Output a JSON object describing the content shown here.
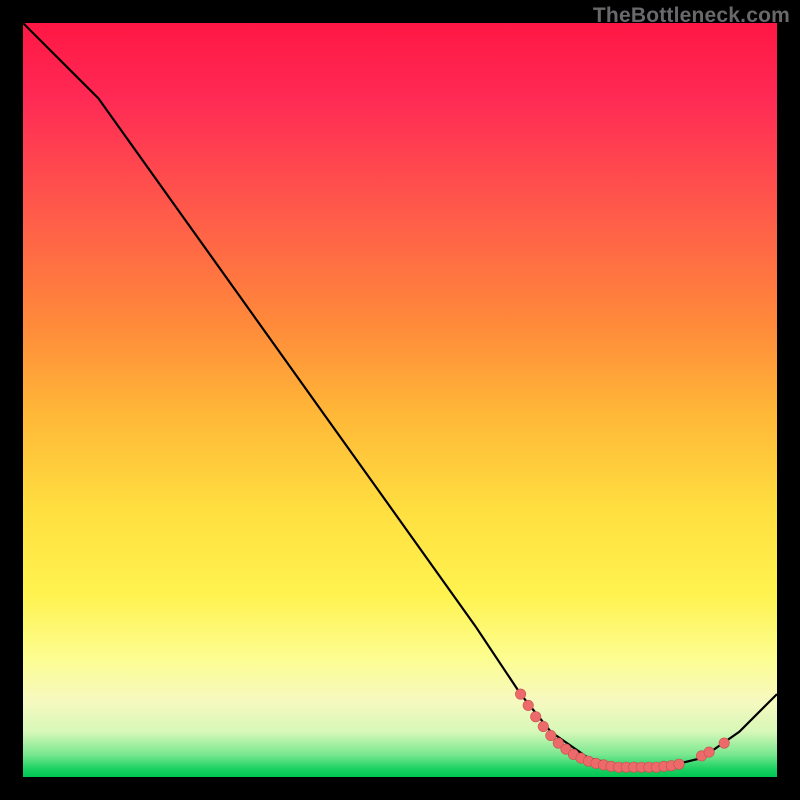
{
  "watermark": "TheBottleneck.com",
  "colors": {
    "curve_stroke": "#000000",
    "point_fill": "#ed6a6a",
    "point_stroke": "#c94f4f"
  },
  "chart_data": {
    "type": "line",
    "title": "",
    "xlabel": "",
    "ylabel": "",
    "xlim": [
      0,
      100
    ],
    "ylim": [
      0,
      100
    ],
    "curve": {
      "x": [
        0,
        3,
        6,
        10,
        20,
        30,
        40,
        50,
        60,
        66,
        70,
        75,
        80,
        85,
        90,
        95,
        100
      ],
      "y": [
        100,
        97,
        94,
        90,
        76,
        62,
        48,
        34,
        20,
        11,
        6,
        2.5,
        1.3,
        1.3,
        2.5,
        6,
        11
      ]
    },
    "points": [
      {
        "x": 66,
        "y": 11.0
      },
      {
        "x": 67,
        "y": 9.5
      },
      {
        "x": 68,
        "y": 8.0
      },
      {
        "x": 69,
        "y": 6.7
      },
      {
        "x": 70,
        "y": 5.5
      },
      {
        "x": 71,
        "y": 4.5
      },
      {
        "x": 72,
        "y": 3.7
      },
      {
        "x": 73,
        "y": 3.0
      },
      {
        "x": 74,
        "y": 2.5
      },
      {
        "x": 75,
        "y": 2.1
      },
      {
        "x": 76,
        "y": 1.8
      },
      {
        "x": 77,
        "y": 1.6
      },
      {
        "x": 78,
        "y": 1.4
      },
      {
        "x": 79,
        "y": 1.3
      },
      {
        "x": 80,
        "y": 1.3
      },
      {
        "x": 81,
        "y": 1.3
      },
      {
        "x": 82,
        "y": 1.3
      },
      {
        "x": 83,
        "y": 1.3
      },
      {
        "x": 84,
        "y": 1.3
      },
      {
        "x": 85,
        "y": 1.4
      },
      {
        "x": 86,
        "y": 1.5
      },
      {
        "x": 87,
        "y": 1.7
      },
      {
        "x": 90,
        "y": 2.8
      },
      {
        "x": 91,
        "y": 3.3
      },
      {
        "x": 93,
        "y": 4.5
      }
    ]
  }
}
